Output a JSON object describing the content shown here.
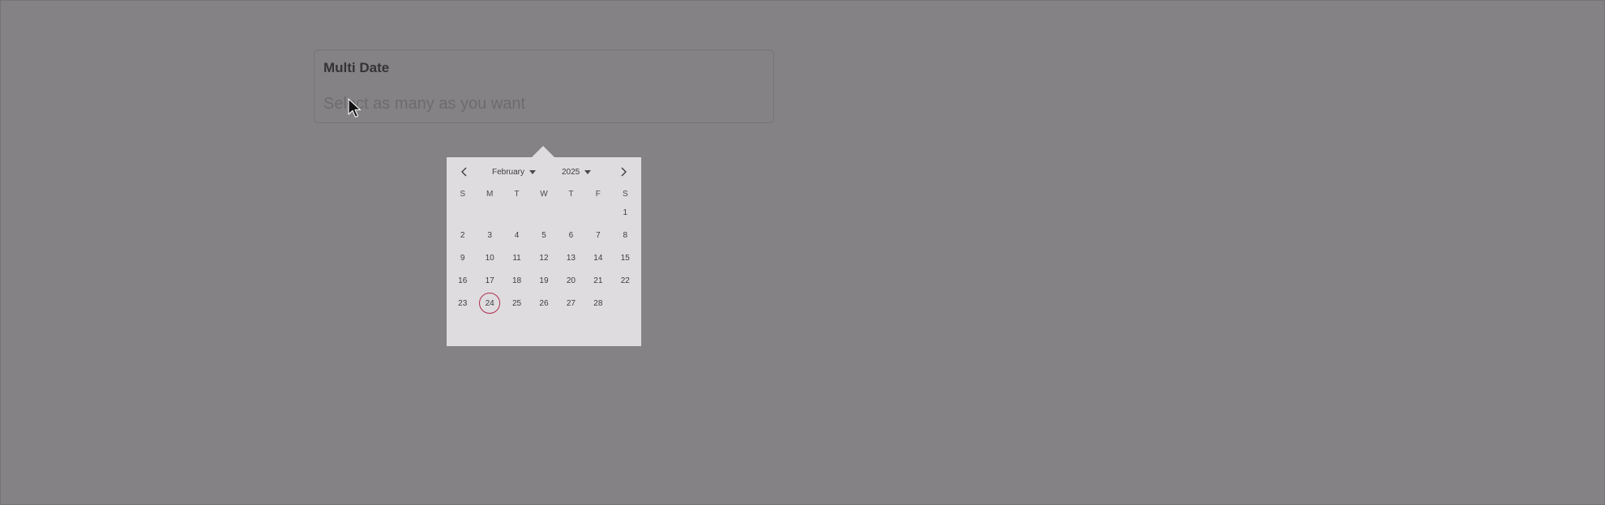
{
  "field": {
    "label": "Multi Date",
    "placeholder": "Select as many as you want",
    "value": ""
  },
  "calendar": {
    "month": "February",
    "year": "2025",
    "weekdays": [
      "S",
      "M",
      "T",
      "W",
      "T",
      "F",
      "S"
    ],
    "weeks": [
      [
        "",
        "",
        "",
        "",
        "",
        "",
        "1"
      ],
      [
        "2",
        "3",
        "4",
        "5",
        "6",
        "7",
        "8"
      ],
      [
        "9",
        "10",
        "11",
        "12",
        "13",
        "14",
        "15"
      ],
      [
        "16",
        "17",
        "18",
        "19",
        "20",
        "21",
        "22"
      ],
      [
        "23",
        "24",
        "25",
        "26",
        "27",
        "28",
        ""
      ]
    ],
    "highlighted_day": "24",
    "icons": {
      "prev": "chevron-left-icon",
      "next": "chevron-right-icon",
      "dropdown": "caret-down-icon"
    }
  },
  "colors": {
    "overlay": "#858285",
    "calendar_bg": "#dedcdf",
    "today_ring": "#b0304f"
  }
}
